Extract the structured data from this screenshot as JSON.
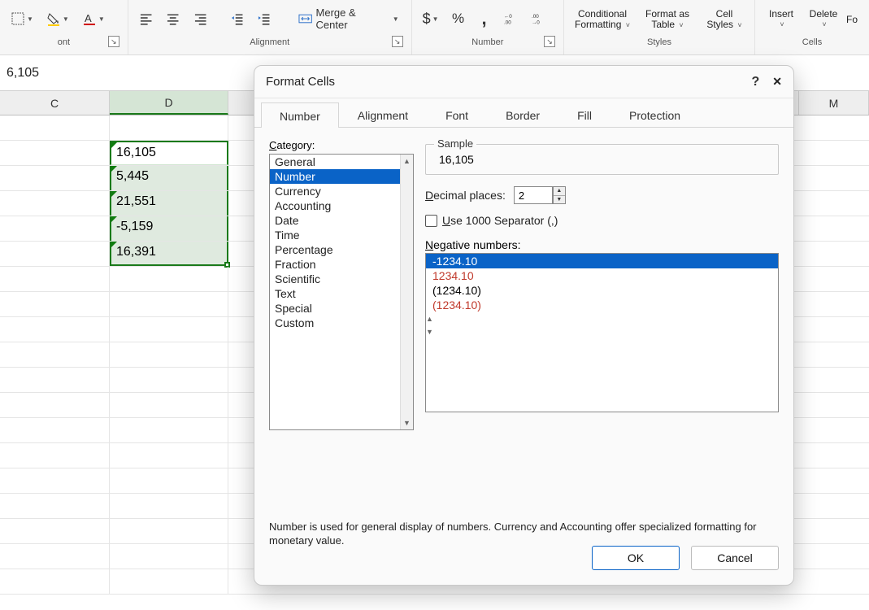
{
  "ribbon": {
    "font_group_label": "ont",
    "alignment": {
      "merge_center": "Merge & Center",
      "group_label": "Alignment"
    },
    "number": {
      "group_label": "Number"
    },
    "styles": {
      "conditional_l1": "Conditional",
      "conditional_l2": "Formatting",
      "format_as_l1": "Format as",
      "format_as_l2": "Table",
      "cell_styles_l1": "Cell",
      "cell_styles_l2": "Styles",
      "group_label": "Styles"
    },
    "cells": {
      "insert": "Insert",
      "delete": "Delete",
      "format_partial": "Fo",
      "group_label": "Cells"
    }
  },
  "formula_bar": {
    "value": "6,105"
  },
  "columns": [
    "C",
    "D",
    "M"
  ],
  "selected_values": [
    "16,105",
    "5,445",
    "21,551",
    "-5,159",
    "16,391"
  ],
  "dialog": {
    "title": "Format Cells",
    "help": "?",
    "close": "✕",
    "tabs": [
      "Number",
      "Alignment",
      "Font",
      "Border",
      "Fill",
      "Protection"
    ],
    "active_tab_index": 0,
    "category_label": "Category:",
    "categories": [
      "General",
      "Number",
      "Currency",
      "Accounting",
      "Date",
      "Time",
      "Percentage",
      "Fraction",
      "Scientific",
      "Text",
      "Special",
      "Custom"
    ],
    "category_selected_index": 1,
    "sample_label": "Sample",
    "sample_value": "16,105",
    "decimal_label_pre": "D",
    "decimal_label_post": "ecimal places:",
    "decimal_value": "2",
    "sep_label_pre": "U",
    "sep_label_post": "se 1000 Separator (,)",
    "neg_label_pre": "N",
    "neg_label_post": "egative numbers:",
    "negative_options": [
      {
        "text": "-1234.10",
        "red": false
      },
      {
        "text": "1234.10",
        "red": true
      },
      {
        "text": "(1234.10)",
        "red": false
      },
      {
        "text": "(1234.10)",
        "red": true
      }
    ],
    "negative_selected_index": 0,
    "description": "Number is used for general display of numbers.  Currency and Accounting offer specialized formatting for monetary value.",
    "ok": "OK",
    "cancel": "Cancel"
  }
}
